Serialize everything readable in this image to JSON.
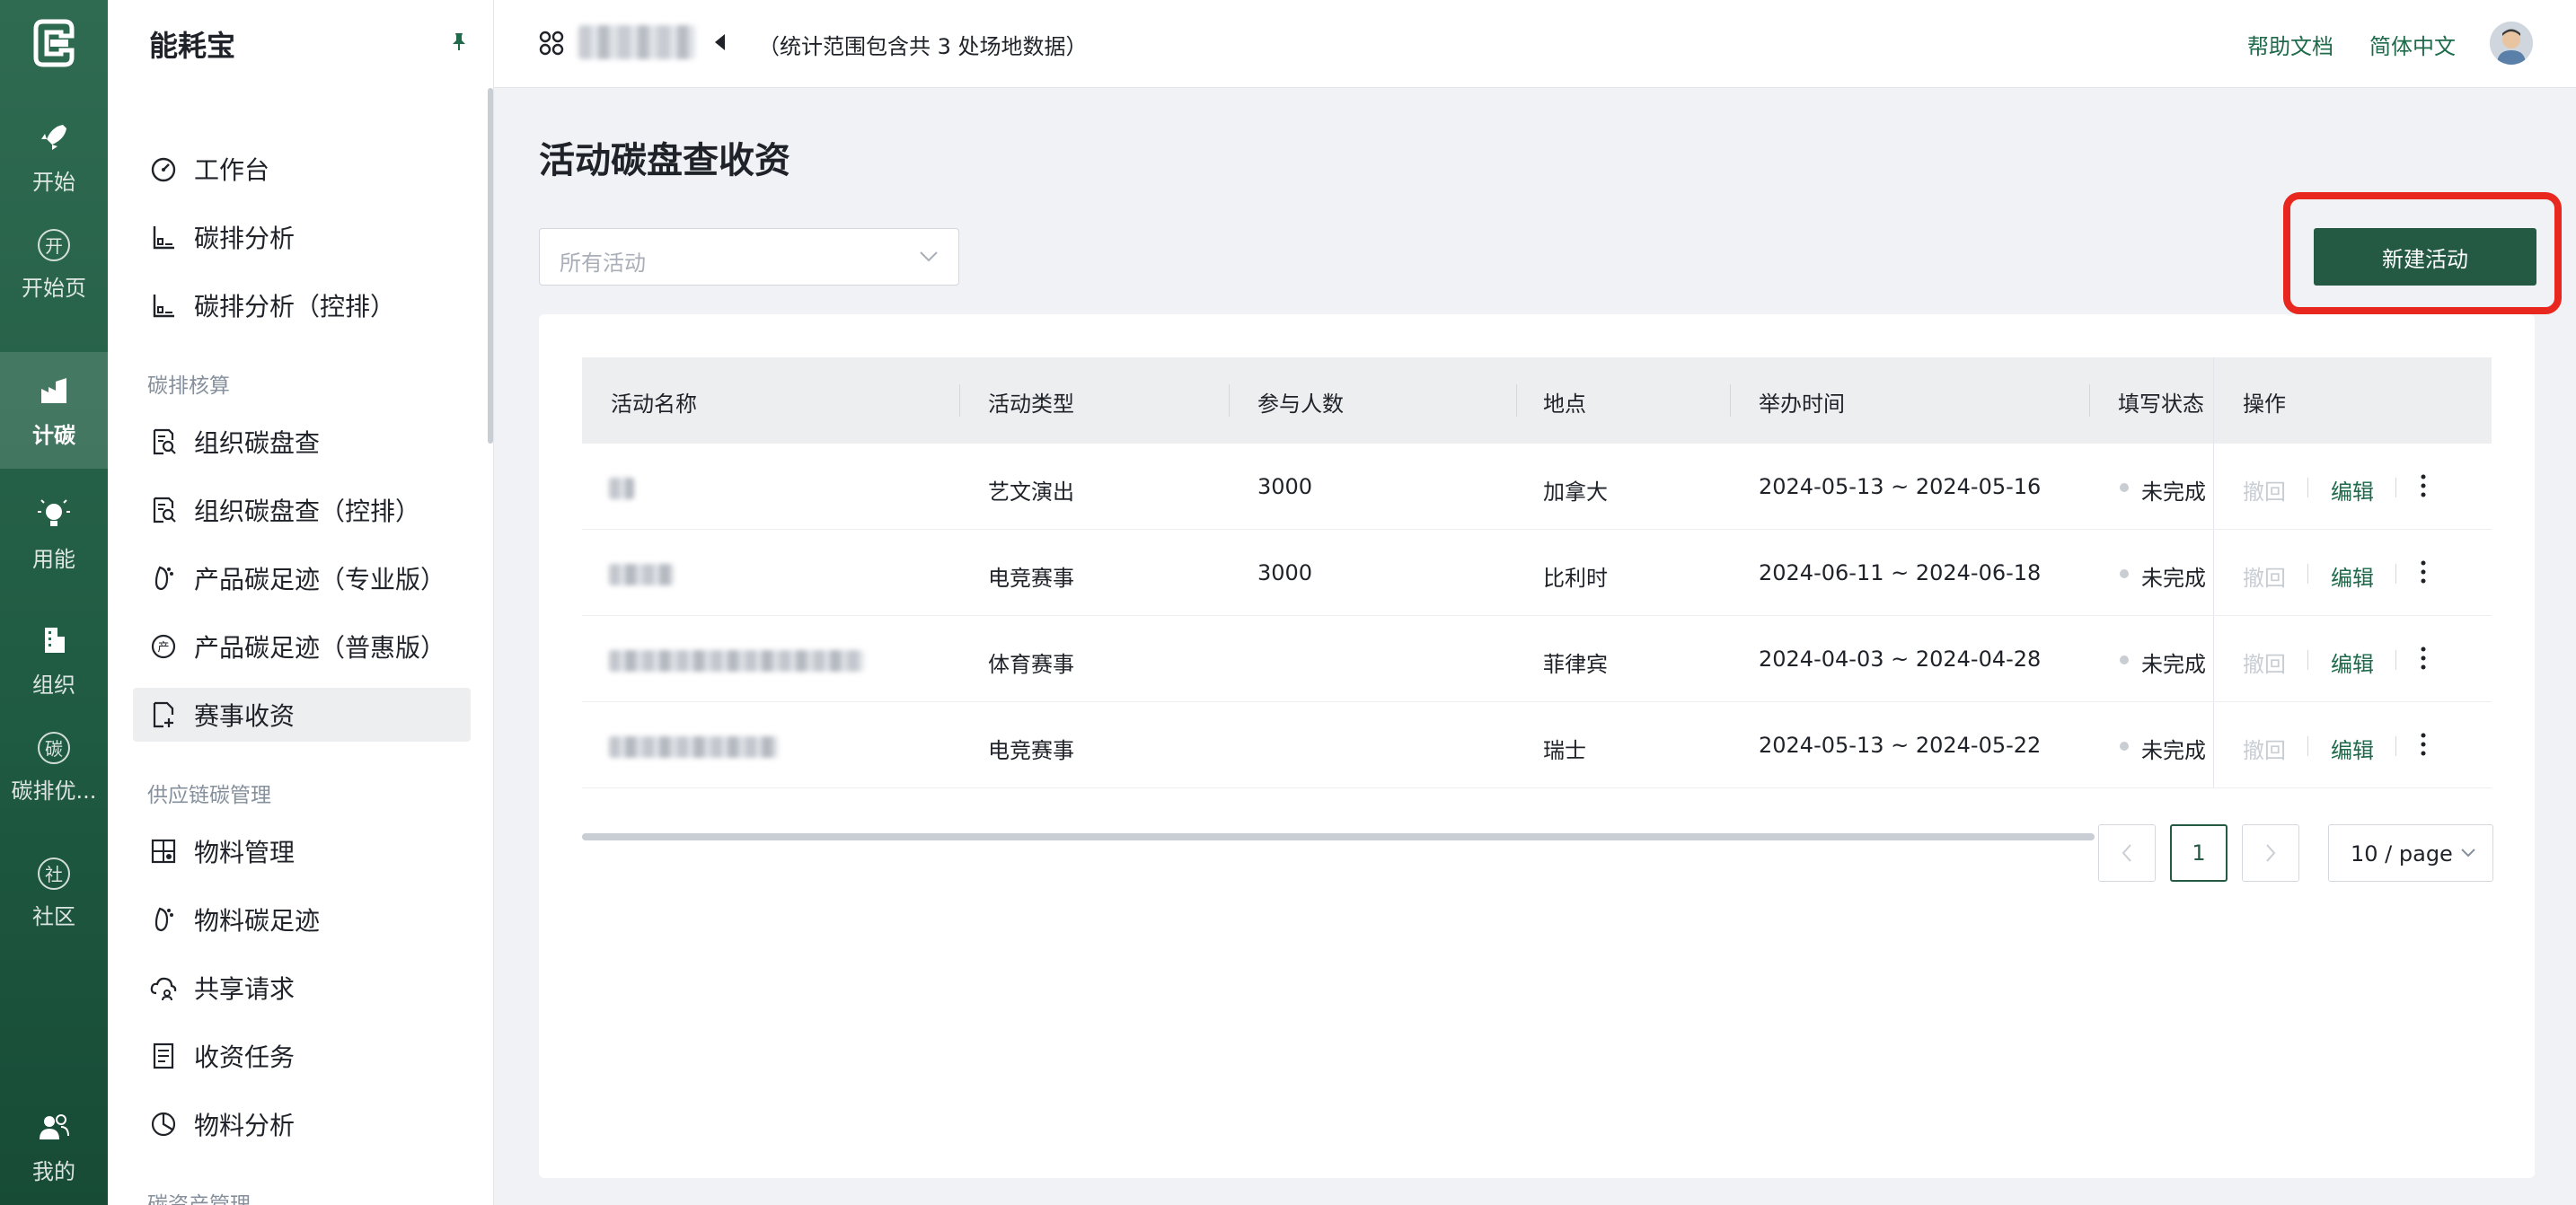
{
  "rail": {
    "items": [
      {
        "label": "开始",
        "icon": "rocket-icon"
      },
      {
        "label": "开始页",
        "glyph": "开"
      },
      {
        "label": "计碳",
        "icon": "factory-icon",
        "active": true
      },
      {
        "label": "用能",
        "icon": "bulb-icon"
      },
      {
        "label": "组织",
        "icon": "building-icon"
      },
      {
        "label": "碳排优...",
        "glyph": "碳"
      },
      {
        "label": "社区",
        "glyph": "社"
      },
      {
        "label": "我的",
        "icon": "users-icon"
      }
    ]
  },
  "sidebar": {
    "title": "能耗宝",
    "items": [
      {
        "label": "工作台",
        "icon": "dashboard-icon"
      },
      {
        "label": "碳排分析",
        "icon": "chart-axis-icon"
      },
      {
        "label": "碳排分析（控排）",
        "icon": "chart-axis-icon"
      }
    ],
    "group1": "碳排核算",
    "group1_items": [
      {
        "label": "组织碳盘查",
        "icon": "doc-search-icon"
      },
      {
        "label": "组织碳盘查（控排）",
        "icon": "doc-search-icon"
      },
      {
        "label": "产品碳足迹（专业版）",
        "icon": "footprint-icon"
      },
      {
        "label": "产品碳足迹（普惠版）",
        "icon": "product-icon"
      },
      {
        "label": "赛事收资",
        "icon": "doc-add-icon",
        "active": true
      }
    ],
    "group2": "供应链碳管理",
    "group2_items": [
      {
        "label": "物料管理",
        "icon": "material-icon"
      },
      {
        "label": "物料碳足迹",
        "icon": "footprint-icon"
      },
      {
        "label": "共享请求",
        "icon": "cloud-share-icon"
      },
      {
        "label": "收资任务",
        "icon": "task-list-icon"
      },
      {
        "label": "物料分析",
        "icon": "pie-icon"
      }
    ],
    "group3": "碳资产管理"
  },
  "topbar": {
    "scope": "（统计范围包含共 3 处场地数据）",
    "help": "帮助文档",
    "lang": "简体中文"
  },
  "main": {
    "title": "活动碳盘查收资",
    "filter_placeholder": "所有活动",
    "new_button": "新建活动"
  },
  "table": {
    "columns": [
      "活动名称",
      "活动类型",
      "参与人数",
      "地点",
      "举办时间",
      "填写状态",
      "操作"
    ],
    "rows": [
      {
        "type": "艺文演出",
        "people": "3000",
        "place": "加拿大",
        "time": "2024-05-13 ~ 2024-05-16",
        "status": "未完成"
      },
      {
        "type": "电竞赛事",
        "people": "3000",
        "place": "比利时",
        "time": "2024-06-11 ~ 2024-06-18",
        "status": "未完成"
      },
      {
        "type": "体育赛事",
        "people": "",
        "place": "菲律宾",
        "time": "2024-04-03 ~ 2024-04-28",
        "status": "未完成"
      },
      {
        "type": "电竞赛事",
        "people": "",
        "place": "瑞士",
        "time": "2024-05-13 ~ 2024-05-22",
        "status": "未完成"
      }
    ],
    "action_withdraw": "撤回",
    "action_edit": "编辑"
  },
  "pagination": {
    "current": "1",
    "page_size": "10 / page"
  },
  "colors": {
    "brand": "#245a44",
    "link": "#1e6a4a",
    "highlight": "#e8271f"
  }
}
